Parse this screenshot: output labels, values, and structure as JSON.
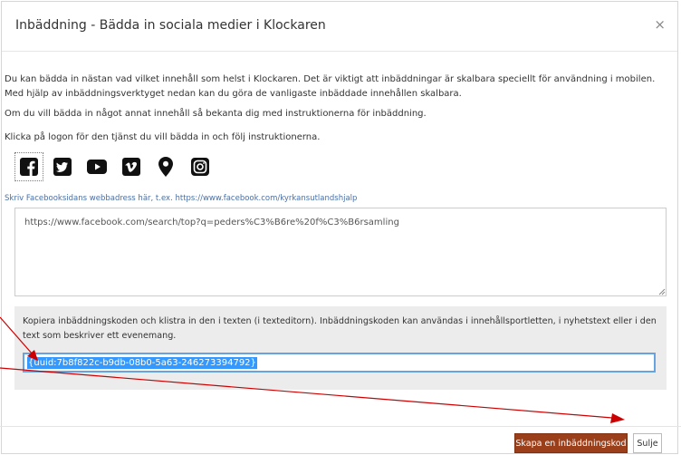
{
  "dialog": {
    "title": "Inbäddning - Bädda in sociala medier i Klockaren",
    "close_label": "×"
  },
  "intro": {
    "paragraph_1": "Du kan bädda in nästan vad vilket innehåll som helst i Klockaren. Det är viktigt att inbäddningar är skalbara speciellt för användning i mobilen. Med hjälp av inbäddningsverktyget nedan kan du göra de vanligaste inbäddade innehållen skalbara.",
    "paragraph_2": "Om du vill bädda in något annat innehåll så bekanta dig med instruktionerna för inbäddning.",
    "paragraph_3": "Klicka på logon för den tjänst du vill bädda in och följ instruktionerna."
  },
  "services": [
    {
      "name": "facebook",
      "icon": "facebook-icon",
      "selected": true
    },
    {
      "name": "twitter",
      "icon": "twitter-icon",
      "selected": false
    },
    {
      "name": "youtube",
      "icon": "youtube-icon",
      "selected": false
    },
    {
      "name": "vimeo",
      "icon": "vimeo-icon",
      "selected": false
    },
    {
      "name": "map",
      "icon": "map-pin-icon",
      "selected": false
    },
    {
      "name": "instagram",
      "icon": "instagram-icon",
      "selected": false
    }
  ],
  "url_input": {
    "hint": "Skriv Facebooksidans webbadress här, t.ex. https://www.facebook.com/kyrkansutlandshjalp",
    "value": "https://www.facebook.com/search/top?q=peders%C3%B6re%20f%C3%B6rsamling"
  },
  "embed": {
    "description": "Kopiera inbäddningskoden och klistra in den i texten (i texteditorn). Inbäddningskoden kan användas i innehållsportletten, i nyhetstext eller i den text som beskriver ett evenemang.",
    "code": "{uuid:7b8f822c-b9db-08b0-5a63-246273394792}"
  },
  "footer": {
    "create_label": "Skapa en inbäddningskod",
    "close_label": "Sulje"
  },
  "colors": {
    "primary_button": "#9b3f1a",
    "annotation_arrow": "#cc0000",
    "selection": "#3399ff"
  }
}
